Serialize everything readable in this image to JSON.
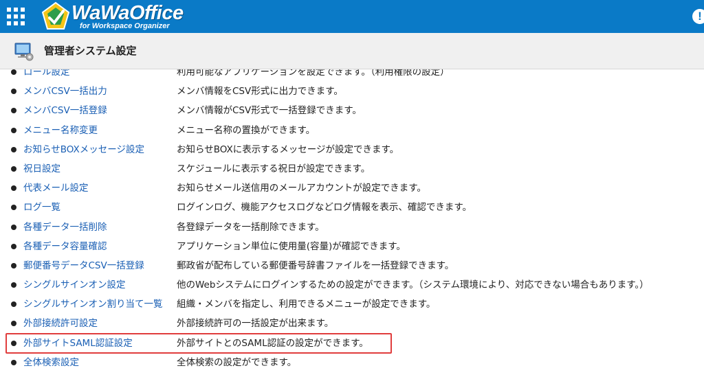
{
  "header": {
    "brand": "WaWaOffice",
    "subtitle": "for Workspace Organizer",
    "alert_glyph": "!",
    "menu_icon": "app-grid-icon",
    "bar_color": "#0a7ac7"
  },
  "page": {
    "title": "管理者システム設定",
    "icon": "computer-settings-icon"
  },
  "items": [
    {
      "label": "ロール設定",
      "desc": "利用可能なアプリケーションを設定できます。（利用権限の設定）"
    },
    {
      "label": "メンバCSV一括出力",
      "desc": "メンバ情報をCSV形式に出力できます。"
    },
    {
      "label": "メンバCSV一括登録",
      "desc": "メンバ情報がCSV形式で一括登録できます。"
    },
    {
      "label": "メニュー名称変更",
      "desc": "メニュー名称の置換ができます。"
    },
    {
      "label": "お知らせBOXメッセージ設定",
      "desc": "お知らせBOXに表示するメッセージが設定できます。"
    },
    {
      "label": "祝日設定",
      "desc": "スケジュールに表示する祝日が設定できます。"
    },
    {
      "label": "代表メール設定",
      "desc": "お知らせメール送信用のメールアカウントが設定できます。"
    },
    {
      "label": "ログ一覧",
      "desc": "ログインログ、機能アクセスログなどログ情報を表示、確認できます。"
    },
    {
      "label": "各種データ一括削除",
      "desc": "各登録データを一括削除できます。"
    },
    {
      "label": "各種データ容量確認",
      "desc": "アプリケーション単位に使用量(容量)が確認できます。"
    },
    {
      "label": "郵便番号データCSV一括登録",
      "desc": "郵政省が配布している郵便番号辞書ファイルを一括登録できます。"
    },
    {
      "label": "シングルサインオン設定",
      "desc": "他のWebシステムにログインするための設定ができます。（システム環境により、対応できない場合もあります。）"
    },
    {
      "label": "シングルサインオン割り当て一覧",
      "desc": "組織・メンバを指定し、利用できるメニューが設定できます。"
    },
    {
      "label": "外部接続許可設定",
      "desc": "外部接続許可の一括設定が出来ます。"
    },
    {
      "label": "外部サイトSAML認証設定",
      "desc": "外部サイトとのSAML認証の設定ができます。"
    },
    {
      "label": "全体検索設定",
      "desc": "全体検索の設定ができます。"
    }
  ],
  "highlight_color": "#e03c3c",
  "highlighted_item": "外部サイトSAML認証設定"
}
